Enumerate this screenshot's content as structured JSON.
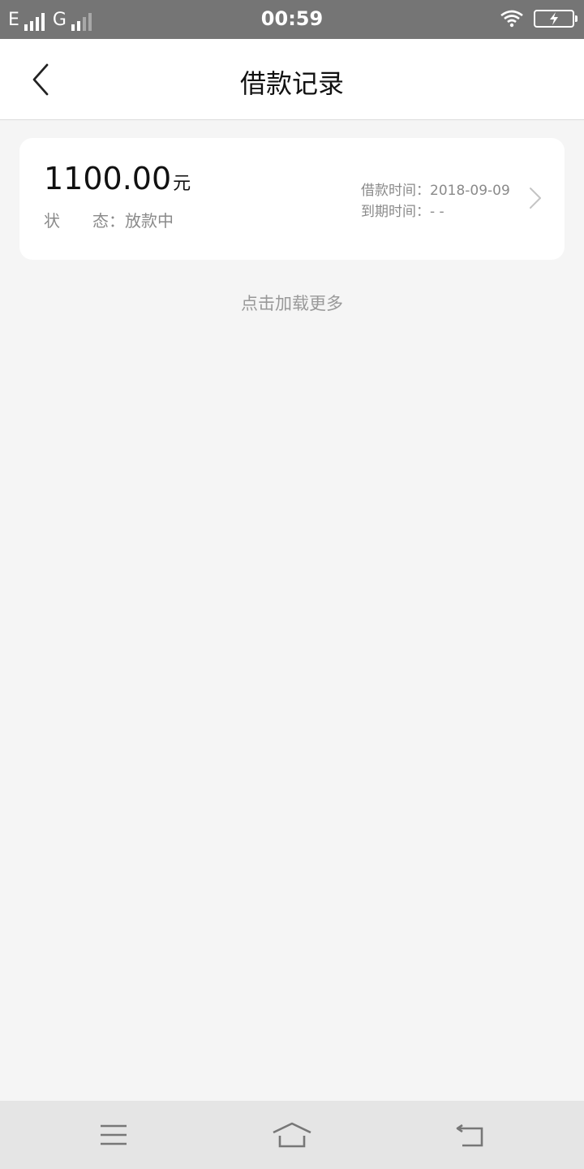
{
  "status_bar": {
    "network_1": "E",
    "network_2": "G",
    "time": "00:59",
    "icons": [
      "signal-icon",
      "wifi-icon",
      "battery-charging-icon"
    ]
  },
  "header": {
    "title": "借款记录",
    "back_icon": "chevron-left-icon"
  },
  "record": {
    "amount": "1100.00",
    "unit": "元",
    "status_label": "状　　态",
    "status_sep": "：",
    "status_value": "放款中",
    "loan_time_label": "借款时间：",
    "loan_time_value": "2018-09-09",
    "due_time_label": "到期时间：",
    "due_time_value": "- -",
    "arrow_icon": "chevron-right-icon"
  },
  "load_more": "点击加载更多",
  "nav": {
    "icons": [
      "menu-icon",
      "home-icon",
      "back-icon"
    ]
  },
  "colors": {
    "status_bar": "#757575",
    "background": "#f5f5f5",
    "secondary_text": "#8a8a8a"
  }
}
